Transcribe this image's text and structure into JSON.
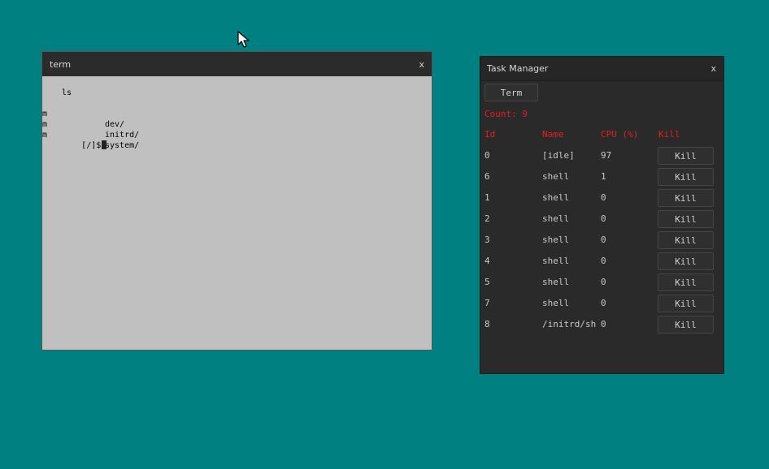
{
  "terminal": {
    "title": "term",
    "close_label": "x",
    "command": "ls",
    "entries": [
      {
        "col1": "m",
        "col2": "dev/"
      },
      {
        "col1": "m",
        "col2": "initrd/"
      },
      {
        "col1": "m",
        "col2": "system/"
      }
    ],
    "prompt": "[/]$"
  },
  "task_manager": {
    "title": "Task Manager",
    "close_label": "x",
    "term_button_label": "Term",
    "count_label": "Count: 9",
    "headers": {
      "id": "Id",
      "name": "Name",
      "cpu": "CPU (%)",
      "kill": "Kill"
    },
    "kill_label": "Kill",
    "processes": [
      {
        "id": "0",
        "name": "[idle]",
        "cpu": "97"
      },
      {
        "id": "6",
        "name": "shell",
        "cpu": "1"
      },
      {
        "id": "1",
        "name": "shell",
        "cpu": "0"
      },
      {
        "id": "2",
        "name": "shell",
        "cpu": "0"
      },
      {
        "id": "3",
        "name": "shell",
        "cpu": "0"
      },
      {
        "id": "4",
        "name": "shell",
        "cpu": "0"
      },
      {
        "id": "5",
        "name": "shell",
        "cpu": "0"
      },
      {
        "id": "7",
        "name": "shell",
        "cpu": "0"
      },
      {
        "id": "8",
        "name": "/initrd/sh",
        "cpu": "0"
      }
    ]
  },
  "colors": {
    "desktop": "#008080",
    "accent_red": "#e02020",
    "terminal_bg": "#c0c0c0",
    "window_dark": "#2a2a2a"
  },
  "icons": {
    "cursor": "mouse-pointer-icon"
  }
}
